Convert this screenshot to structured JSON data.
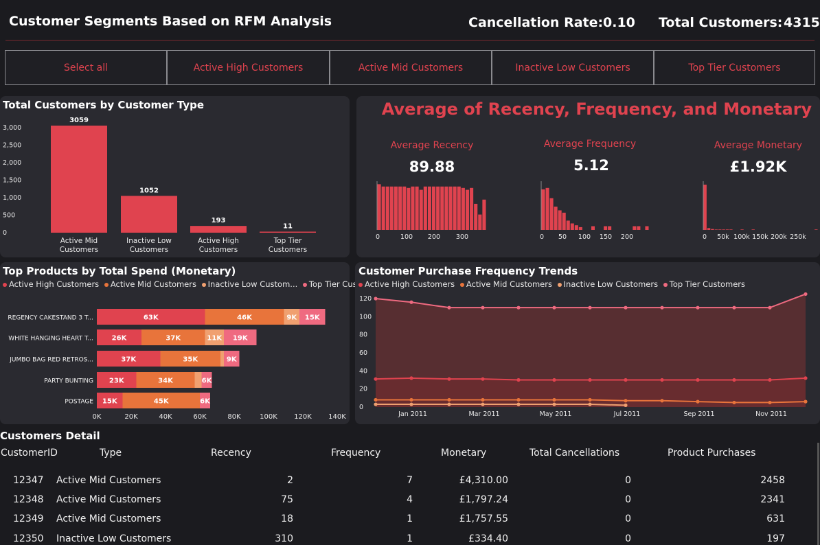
{
  "header": {
    "title": "Customer Segments Based on RFM Analysis",
    "cancellation_label": "Cancellation Rate:",
    "cancellation_value": "0.10",
    "customers_label": "Total Customers:",
    "customers_value": "4315"
  },
  "slicer": {
    "buttons": [
      "Select all",
      "Active High Customers",
      "Active Mid Customers",
      "Inactive Low Customers",
      "Top Tier Customers"
    ]
  },
  "colors": {
    "accent": "#e0434f",
    "orange": "#e8743b",
    "peach": "#f0a070",
    "pink": "#ef6a80",
    "area_fill": "#5a2e32"
  },
  "customers_by_type": {
    "title": "Total Customers by Customer Type",
    "categories": [
      [
        "Active Mid",
        "Customers"
      ],
      [
        "Inactive Low",
        "Customers"
      ],
      [
        "Active High",
        "Customers"
      ],
      [
        "Top Tier",
        "Customers"
      ]
    ],
    "values": [
      3059,
      1052,
      193,
      11
    ],
    "value_labels": [
      "3059",
      "1052",
      "193",
      "11"
    ],
    "y_ticks": [
      "3,000",
      "2,500",
      "2,000",
      "1,500",
      "1,000",
      "500",
      "0"
    ]
  },
  "rfm": {
    "heading": "Average of Recency, Frequency, and Monetary",
    "recency": {
      "label": "Average Recency",
      "value": "89.88",
      "ticks": [
        "0",
        "100",
        "200",
        "300"
      ],
      "hist": [
        0.98,
        0.93,
        0.93,
        0.93,
        0.93,
        0.93,
        0.93,
        0.9,
        0.93,
        0.93,
        0.86,
        0.93,
        0.93,
        0.93,
        0.93,
        0.93,
        0.93,
        0.93,
        0.93,
        0.93,
        0.9,
        0.86,
        0.9,
        0.56,
        0.33,
        0.65
      ]
    },
    "frequency": {
      "label": "Average Frequency",
      "value": "5.12",
      "ticks": [
        "0",
        "50",
        "100",
        "150",
        "200"
      ],
      "hist": [
        0.87,
        0.9,
        0.68,
        0.5,
        0.42,
        0.37,
        0.2,
        0.14,
        0.1,
        0.06,
        0.0,
        0.0,
        0.08,
        0.0,
        0.0,
        0.08,
        0.08,
        0.0,
        0.0,
        0.0,
        0.0,
        0.0,
        0.08,
        0.08,
        0.0,
        0.08
      ]
    },
    "monetary": {
      "label": "Average Monetary",
      "value": "£1.92K",
      "ticks": [
        "0",
        "50k",
        "100k",
        "150k",
        "200k",
        "250k"
      ],
      "hist": [
        0.97,
        0.04,
        0.02,
        0.01,
        0.01,
        0.01,
        0.01,
        0.01,
        0.0,
        0.0,
        0.01,
        0.0,
        0.0,
        0.01,
        0.0,
        0.0,
        0.0,
        0.0,
        0.0,
        0.0,
        0.0,
        0.0,
        0.0,
        0.0,
        0.0,
        0.0,
        0.0,
        0.0,
        0.0,
        0.0,
        0.01
      ]
    }
  },
  "top_products": {
    "title": "Top Products by Total Spend (Monetary)",
    "legend": [
      "Active High Customers",
      "Active Mid Customers",
      "Inactive Low Custom...",
      "Top Tier Cust..."
    ],
    "products": [
      "REGENCY CAKESTAND 3 T...",
      "WHITE HANGING HEART T...",
      "JUMBO BAG RED RETROS...",
      "PARTY BUNTING",
      "POSTAGE"
    ],
    "segments": [
      [
        63,
        46,
        9,
        15
      ],
      [
        26,
        37,
        11,
        19
      ],
      [
        37,
        35,
        2,
        9
      ],
      [
        23,
        34,
        4,
        6
      ],
      [
        15,
        45,
        0,
        6
      ]
    ],
    "segment_labels": [
      [
        "63K",
        "46K",
        "9K",
        "15K"
      ],
      [
        "26K",
        "37K",
        "11K",
        "19K"
      ],
      [
        "37K",
        "35K",
        "",
        "9K"
      ],
      [
        "23K",
        "34K",
        "",
        "6K"
      ],
      [
        "15K",
        "45K",
        "",
        "6K"
      ]
    ],
    "x_ticks": [
      "0K",
      "20K",
      "40K",
      "60K",
      "80K",
      "100K",
      "120K",
      "140K"
    ]
  },
  "frequency_trends": {
    "title": "Customer Purchase Frequency Trends",
    "legend": [
      "Active High Customers",
      "Active Mid Customers",
      "Inactive Low Customers",
      "Top Tier Customers"
    ],
    "y_ticks": [
      "120",
      "100",
      "80",
      "60",
      "40",
      "20",
      "0"
    ],
    "x_ticks": [
      "Jan 2011",
      "Mar 2011",
      "May 2011",
      "Jul 2011",
      "Sep 2011",
      "Nov 2011"
    ]
  },
  "chart_data": [
    {
      "type": "bar",
      "title": "Total Customers by Customer Type",
      "categories": [
        "Active Mid Customers",
        "Inactive Low Customers",
        "Active High Customers",
        "Top Tier Customers"
      ],
      "values": [
        3059,
        1052,
        193,
        11
      ],
      "ylim": [
        0,
        3000
      ]
    },
    {
      "type": "bar",
      "title": "Top Products by Total Spend (Monetary)",
      "categories": [
        "REGENCY CAKESTAND 3 T...",
        "WHITE HANGING HEART T...",
        "JUMBO BAG RED RETROS...",
        "PARTY BUNTING",
        "POSTAGE"
      ],
      "series": [
        {
          "name": "Active High Customers",
          "values": [
            63000,
            26000,
            37000,
            23000,
            15000
          ]
        },
        {
          "name": "Active Mid Customers",
          "values": [
            46000,
            37000,
            35000,
            34000,
            45000
          ]
        },
        {
          "name": "Inactive Low Customers",
          "values": [
            9000,
            11000,
            2000,
            4000,
            0
          ]
        },
        {
          "name": "Top Tier Customers",
          "values": [
            15000,
            19000,
            9000,
            6000,
            6000
          ]
        }
      ],
      "xlim": [
        0,
        140000
      ]
    },
    {
      "type": "line",
      "title": "Customer Purchase Frequency Trends",
      "x": [
        "Dec 2010",
        "Jan 2011",
        "Feb 2011",
        "Mar 2011",
        "Apr 2011",
        "May 2011",
        "Jun 2011",
        "Jul 2011",
        "Aug 2011",
        "Sep 2011",
        "Oct 2011",
        "Nov 2011",
        "Dec 2011"
      ],
      "series": [
        {
          "name": "Top Tier Customers",
          "values": [
            120,
            116,
            110,
            110,
            110,
            110,
            110,
            110,
            110,
            110,
            110,
            110,
            125
          ]
        },
        {
          "name": "Active High Customers",
          "values": [
            31,
            32,
            31,
            31,
            30,
            30,
            30,
            30,
            30,
            30,
            30,
            30,
            32
          ]
        },
        {
          "name": "Active Mid Customers",
          "values": [
            8,
            8,
            8,
            8,
            8,
            8,
            8,
            7,
            7,
            6,
            5,
            5,
            6
          ]
        },
        {
          "name": "Inactive Low Customers",
          "values": [
            3,
            3,
            3,
            3,
            3,
            3,
            3,
            2,
            null,
            null,
            null,
            null,
            null
          ]
        }
      ],
      "ylim": [
        0,
        130
      ]
    }
  ],
  "customers_detail": {
    "title": "Customers Detail",
    "columns": [
      "CustomerID",
      "Type",
      "Recency",
      "Frequency",
      "Monetary",
      "Total Cancellations",
      "Product Purchases"
    ],
    "rows": [
      [
        "12347",
        "Active Mid Customers",
        "2",
        "7",
        "£4,310.00",
        "0",
        "2458"
      ],
      [
        "12348",
        "Active Mid Customers",
        "75",
        "4",
        "£1,797.24",
        "0",
        "2341"
      ],
      [
        "12349",
        "Active Mid Customers",
        "18",
        "1",
        "£1,757.55",
        "0",
        "631"
      ],
      [
        "12350",
        "Inactive Low Customers",
        "310",
        "1",
        "£334.40",
        "0",
        "197"
      ]
    ]
  }
}
